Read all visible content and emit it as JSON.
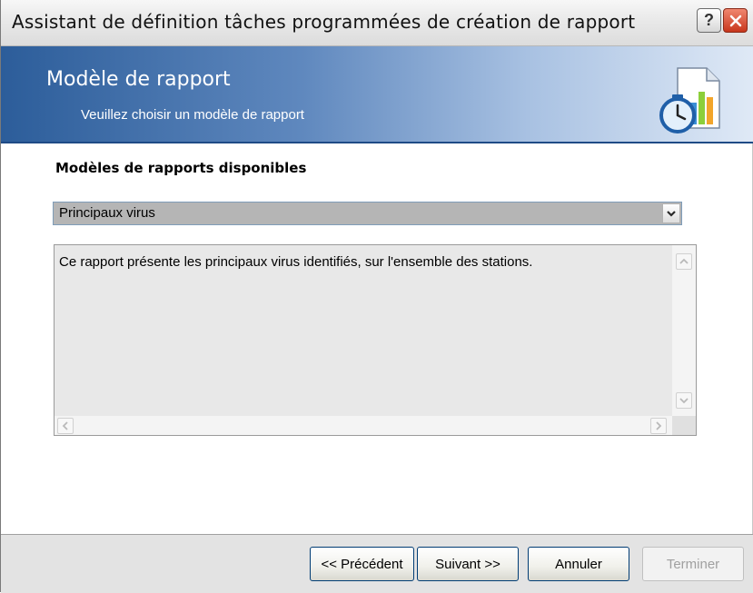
{
  "window": {
    "title": "Assistant de définition tâches programmées de création de rapport",
    "help_glyph": "?",
    "close_icon": "close-icon"
  },
  "banner": {
    "heading": "Modèle de rapport",
    "subheading": "Veuillez choisir un modèle de rapport",
    "icon": "scheduled-report-icon"
  },
  "templates": {
    "label": "Modèles de rapports disponibles",
    "selected": "Principaux virus"
  },
  "description": {
    "text": "Ce rapport présente les principaux virus identifiés, sur l'ensemble des stations."
  },
  "buttons": {
    "previous": "<< Précédent",
    "next": "Suivant >>",
    "cancel": "Annuler",
    "finish": "Terminer"
  },
  "colors": {
    "banner_start": "#2c5d9a",
    "banner_end": "#dfe9f6",
    "close_red": "#c8361c"
  }
}
